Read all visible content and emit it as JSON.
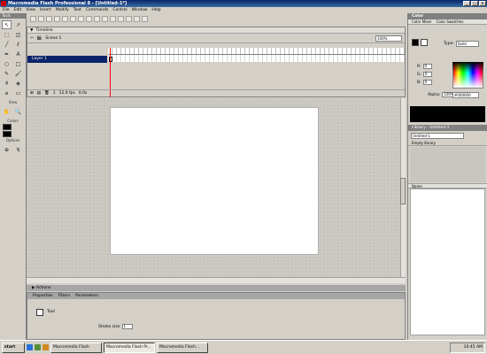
{
  "window": {
    "title": "Macromedia Flash Professional 8 - [Untitled-1*]",
    "controls": [
      "_",
      "□",
      "×"
    ]
  },
  "menubar": {
    "items": [
      "File",
      "Edit",
      "View",
      "Insert",
      "Modify",
      "Text",
      "Commands",
      "Control",
      "Window",
      "Help"
    ]
  },
  "toolbox": {
    "title": "Tools",
    "tools": [
      {
        "icon": "arrow-icon",
        "glyph": "↖"
      },
      {
        "icon": "subselect-icon",
        "glyph": "↗"
      },
      {
        "icon": "free-transform-icon",
        "glyph": "⬚"
      },
      {
        "icon": "gradient-transform-icon",
        "glyph": "◫"
      },
      {
        "icon": "line-icon",
        "glyph": "╱"
      },
      {
        "icon": "lasso-icon",
        "glyph": "ℓ"
      },
      {
        "icon": "pen-icon",
        "glyph": "✒"
      },
      {
        "icon": "text-icon",
        "glyph": "A"
      },
      {
        "icon": "oval-icon",
        "glyph": "○"
      },
      {
        "icon": "rectangle-icon",
        "glyph": "□"
      },
      {
        "icon": "pencil-icon",
        "glyph": "✎"
      },
      {
        "icon": "brush-icon",
        "glyph": "🖌"
      },
      {
        "icon": "ink-bottle-icon",
        "glyph": "⚱"
      },
      {
        "icon": "paint-bucket-icon",
        "glyph": "◈"
      },
      {
        "icon": "eyedropper-icon",
        "glyph": "⌀"
      },
      {
        "icon": "eraser-icon",
        "glyph": "▭"
      }
    ],
    "view_label": "View",
    "view_tools": [
      {
        "icon": "hand-icon",
        "glyph": "✋"
      },
      {
        "icon": "zoom-icon",
        "glyph": "🔍"
      }
    ],
    "colors_label": "Colors",
    "stroke_color": "#000000",
    "fill_color": "#000000",
    "options_label": "Options"
  },
  "timeline": {
    "tab_label": "Timeline",
    "scene_label": "Scene 1",
    "zoom_value": "100%",
    "layer_name": "Layer 1",
    "footer_fps": "12.0 fps",
    "footer_time": "0.0s",
    "footer_frame": "1"
  },
  "stage": {
    "background": "#ffffff"
  },
  "actions_panel": {
    "title": "Actions"
  },
  "properties_panel": {
    "tabs": [
      "Properties",
      "Filters",
      "Parameters"
    ],
    "doc_label": "Tool",
    "field_label": "Stroke size",
    "field_value": "1"
  },
  "color_panel": {
    "title": "Color",
    "tabs": [
      "Color Mixer",
      "Color Swatches"
    ],
    "type_label": "Type:",
    "type_value": "Solid",
    "r_label": "R:",
    "r_value": "0",
    "g_label": "G:",
    "g_value": "0",
    "b_label": "B:",
    "b_value": "0",
    "alpha_label": "Alpha:",
    "alpha_value": "100%",
    "hex_value": "#000000"
  },
  "library_panel": {
    "title": "Library - Untitled-1",
    "doc_select": "Untitled-1",
    "count": "Empty library",
    "name_header": "Name"
  },
  "taskbar": {
    "start_label": "start",
    "tasks": [
      "Macromedia Flash",
      "Macromedia Flash Pr...",
      "Macromedia Flash..."
    ],
    "clock": "10:45 AM"
  }
}
